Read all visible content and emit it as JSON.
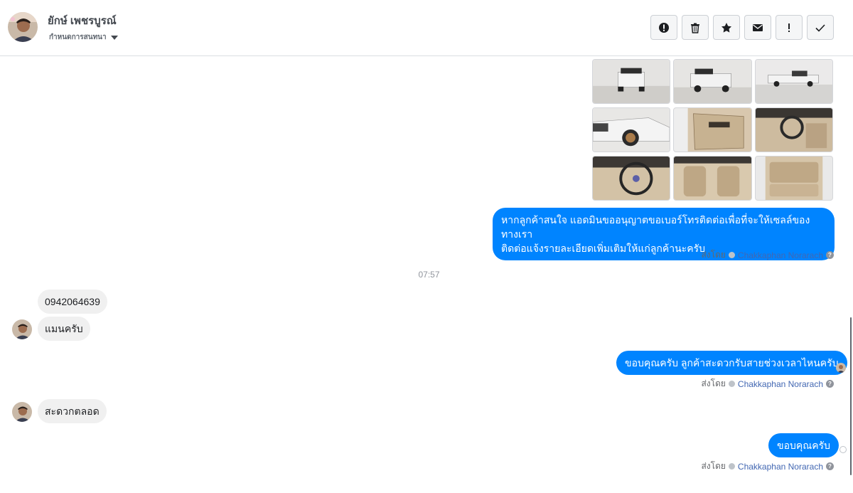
{
  "header": {
    "contact_name": "ยักษ์ เพชรบูรณ์",
    "status_label": "กำหนดการสนทนา",
    "toolbar": {
      "icons": [
        "alert-icon",
        "trash-icon",
        "star-icon",
        "envelope-icon",
        "exclamation-icon",
        "check-icon"
      ]
    }
  },
  "thread": {
    "photos": [
      {
        "alt": "truck-rear-view"
      },
      {
        "alt": "truck-rear-angle"
      },
      {
        "alt": "truck-side-view"
      },
      {
        "alt": "truck-front-wheel"
      },
      {
        "alt": "door-panel-interior"
      },
      {
        "alt": "driver-seat-interior"
      },
      {
        "alt": "steering-wheel"
      },
      {
        "alt": "front-seats"
      },
      {
        "alt": "rear-seats"
      }
    ],
    "messages": [
      {
        "from": "page",
        "text_line1": "หากลูกค้าสนใจ แอดมินขออนุญาตขอเบอร์โทรติดต่อเพื่อที่จะให้เซลล์ของทางเรา",
        "text_line2": "ติดต่อแจ้งรายละเอียดเพิ่มเติมให้แก่ลูกค้านะครับ",
        "sent_by_prefix": "ส่งโดย",
        "agent": "Chakkaphan Norarach",
        "help": "?"
      },
      {
        "timestamp": "07:57"
      },
      {
        "from": "customer",
        "text": "0942064639"
      },
      {
        "from": "customer",
        "text": "แมนครับ"
      },
      {
        "from": "page",
        "text": "ขอบคุณครับ ลูกค้าสะดวกรับสายช่วงเวลาไหนครับ",
        "sent_by_prefix": "ส่งโดย",
        "agent": "Chakkaphan Norarach",
        "help": "?"
      },
      {
        "from": "customer",
        "text": "สะดวกตลอด"
      },
      {
        "from": "page",
        "text": "ขอบคุณครับ",
        "sent_by_prefix": "ส่งโดย",
        "agent": "Chakkaphan Norarach",
        "help": "?"
      }
    ]
  },
  "colors": {
    "outgoing_bubble": "#0084ff",
    "incoming_bubble": "#f0f0f0",
    "agent_link": "#4267b2"
  }
}
